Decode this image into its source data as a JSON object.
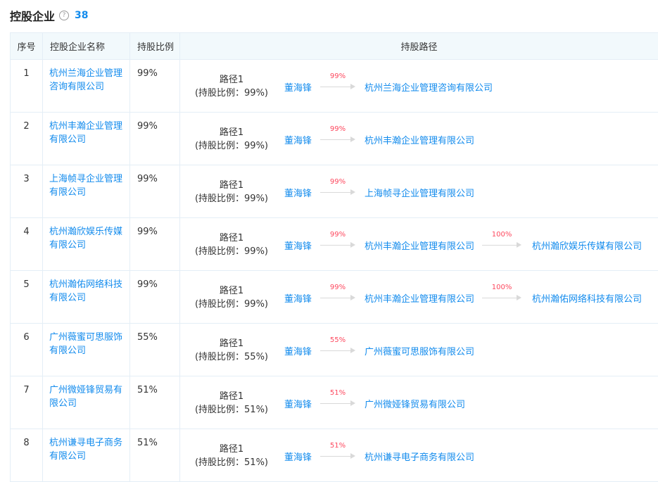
{
  "header": {
    "title": "控股企业",
    "help_icon": "question-circle-icon",
    "count": "38"
  },
  "table": {
    "columns": [
      "序号",
      "控股企业名称",
      "持股比例",
      "持股路径"
    ],
    "rows": [
      {
        "index": "1",
        "name_lines": [
          "杭州兰海企业管理",
          "咨询有限公司"
        ],
        "ratio": "99%",
        "path_label": "路径1",
        "path_ratio": "(持股比例：99%)",
        "chain": [
          {
            "node": "董海锋"
          },
          {
            "pct": "99%",
            "node": "杭州兰海企业管理咨询有限公司"
          }
        ]
      },
      {
        "index": "2",
        "name_lines": [
          "杭州丰瀚企业管理",
          "有限公司"
        ],
        "ratio": "99%",
        "path_label": "路径1",
        "path_ratio": "(持股比例：99%)",
        "chain": [
          {
            "node": "董海锋"
          },
          {
            "pct": "99%",
            "node": "杭州丰瀚企业管理有限公司"
          }
        ]
      },
      {
        "index": "3",
        "name_lines": [
          "上海帧寻企业管理",
          "有限公司"
        ],
        "ratio": "99%",
        "path_label": "路径1",
        "path_ratio": "(持股比例：99%)",
        "chain": [
          {
            "node": "董海锋"
          },
          {
            "pct": "99%",
            "node": "上海帧寻企业管理有限公司"
          }
        ]
      },
      {
        "index": "4",
        "name_lines": [
          "杭州瀚欣娱乐传媒",
          "有限公司"
        ],
        "ratio": "99%",
        "path_label": "路径1",
        "path_ratio": "(持股比例：99%)",
        "chain": [
          {
            "node": "董海锋"
          },
          {
            "pct": "99%",
            "node": "杭州丰瀚企业管理有限公司"
          },
          {
            "pct": "100%",
            "node": "杭州瀚欣娱乐传媒有限公司"
          }
        ]
      },
      {
        "index": "5",
        "name_lines": [
          "杭州瀚佑网络科技",
          "有限公司"
        ],
        "ratio": "99%",
        "path_label": "路径1",
        "path_ratio": "(持股比例：99%)",
        "chain": [
          {
            "node": "董海锋"
          },
          {
            "pct": "99%",
            "node": "杭州丰瀚企业管理有限公司"
          },
          {
            "pct": "100%",
            "node": "杭州瀚佑网络科技有限公司"
          }
        ]
      },
      {
        "index": "6",
        "name_lines": [
          "广州薇蜜可思服饰",
          "有限公司"
        ],
        "ratio": "55%",
        "path_label": "路径1",
        "path_ratio": "(持股比例：55%)",
        "chain": [
          {
            "node": "董海锋"
          },
          {
            "pct": "55%",
            "node": "广州薇蜜可思服饰有限公司"
          }
        ]
      },
      {
        "index": "7",
        "name_lines": [
          "广州微娅锋贸易有",
          "限公司"
        ],
        "ratio": "51%",
        "path_label": "路径1",
        "path_ratio": "(持股比例：51%)",
        "chain": [
          {
            "node": "董海锋"
          },
          {
            "pct": "51%",
            "node": "广州微娅锋贸易有限公司"
          }
        ]
      },
      {
        "index": "8",
        "name_lines": [
          "杭州谦寻电子商务",
          "有限公司"
        ],
        "ratio": "51%",
        "path_label": "路径1",
        "path_ratio": "(持股比例：51%)",
        "chain": [
          {
            "node": "董海锋"
          },
          {
            "pct": "51%",
            "node": "杭州谦寻电子商务有限公司"
          }
        ]
      }
    ]
  }
}
